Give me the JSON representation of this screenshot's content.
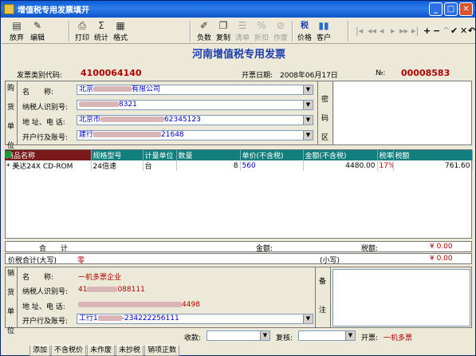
{
  "window": {
    "title": "增值税专用发票填开",
    "controls": [
      "_",
      "□",
      "✕"
    ]
  },
  "toolbar": {
    "items": [
      {
        "label": "放弃",
        "icon": "discard-icon"
      },
      {
        "label": "编辑",
        "icon": "edit-icon"
      },
      {
        "label": "打印",
        "icon": "print-icon"
      },
      {
        "label": "统计",
        "icon": "sum-icon"
      },
      {
        "label": "格式",
        "icon": "format-icon"
      },
      {
        "label": "负数",
        "icon": "negative-icon"
      },
      {
        "label": "复制",
        "icon": "copy-icon"
      },
      {
        "label": "清单",
        "icon": "list-icon"
      },
      {
        "label": "折扣",
        "icon": "discount-icon"
      },
      {
        "label": "作废",
        "icon": "void-icon"
      },
      {
        "label": "价格",
        "icon": "price-icon"
      },
      {
        "label": "客户",
        "icon": "customer-icon"
      }
    ],
    "nav": [
      "|◂",
      "◂◂",
      "◂",
      "▸",
      "▸▸",
      "▸|",
      "+",
      "−",
      "^",
      "✔",
      "✕",
      "↶"
    ]
  },
  "invoice": {
    "title": "河南增值税专用发票",
    "type_code_label": "发票类别代码:",
    "type_code": "4100064140",
    "date_label": "开票日期:",
    "date": "2008年06月17日",
    "no_label": "№:",
    "no": "00008583"
  },
  "buyer": {
    "side_label": [
      "购",
      "货",
      "单",
      "位"
    ],
    "name_label": "名　　称:",
    "name_value_prefix": "北京",
    "name_value_suffix": "有限公司",
    "tax_id_label": "纳税人识别号:",
    "tax_id_suffix": "8321",
    "address_label": "地 址、电 话:",
    "address_prefix": "北京市",
    "address_suffix": "62345123",
    "bank_label": "开户行及账号:",
    "bank_prefix": "建行",
    "bank_suffix": "21648",
    "code_area_label": [
      "密",
      "码",
      "区"
    ]
  },
  "items": {
    "columns": [
      "商品名称",
      "规格型号",
      "计量单位",
      "数量",
      "单价(不含税)",
      "金额(不含税)",
      "税率",
      "税额"
    ],
    "rows": [
      {
        "marker": "*",
        "name": "美达24X CD-ROM",
        "spec": "24倍速",
        "unit": "台",
        "qty": "8",
        "price": "560",
        "amount": "4480.00",
        "rate": "17%",
        "tax": "761.60"
      }
    ]
  },
  "totals": {
    "label": "合　　计",
    "amount_label": "金额:",
    "amount": "¥ 0.00",
    "tax_label": "税额:",
    "tax": "¥ 0.00",
    "tax_total_label": "价税合计(大写)",
    "tax_total_words": "零",
    "small_label": "(小写)",
    "small_value": "¥ 0.00"
  },
  "seller": {
    "side_label": [
      "销",
      "货",
      "单",
      "位"
    ],
    "name_label": "名　　称:",
    "name_value": "一机多票企业",
    "tax_id_label": "纳税人识别号:",
    "tax_id_prefix": "41",
    "tax_id_suffix": "088111",
    "address_label": "地 址、电 话:",
    "address_suffix": "4498",
    "bank_label": "开户行及账号:",
    "bank_prefix": "工行1",
    "bank_suffix": "-234222256111",
    "remark_label": [
      "备",
      "注"
    ]
  },
  "footer": {
    "receiver_label": "收款:",
    "reviewer_label": "复核:",
    "issuer_label": "开票:",
    "issuer": "一机多票"
  },
  "status": [
    "添加",
    "不含税价",
    "未作废",
    "未抄税",
    "销项正数"
  ]
}
